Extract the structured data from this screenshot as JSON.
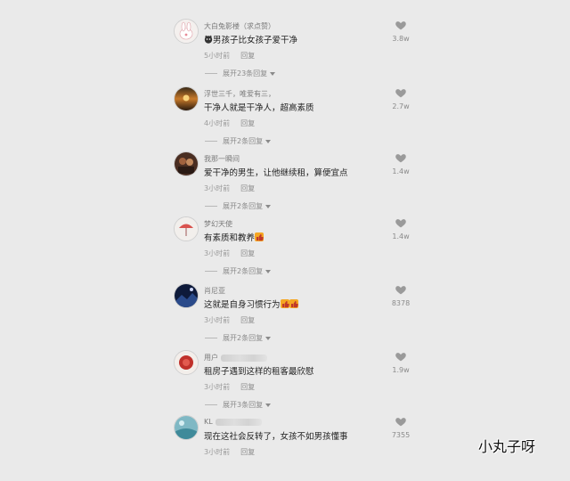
{
  "comments": [
    {
      "user": "大白兔影楼（求点赞）",
      "text": "男孩子比女孩子爱干净",
      "time": "5小时前",
      "reply": "回复",
      "expand": "展开23条回复",
      "likes": "3.8w",
      "avatar": "bunny-avatar"
    },
    {
      "user": "浮世三千，唯爱有三，",
      "text": "干净人就是干净人，超高素质",
      "time": "4小时前",
      "reply": "回复",
      "expand": "展开2条回复",
      "likes": "2.7w",
      "avatar": "sunset-avatar"
    },
    {
      "user": "我那一瞬间",
      "text": "爱干净的男生，让他继续租，算便宜点",
      "time": "3小时前",
      "reply": "回复",
      "expand": "展开2条回复",
      "likes": "1.4w",
      "avatar": "photo-avatar"
    },
    {
      "user": "梦幻天使",
      "text": "有素质和教养",
      "time": "3小时前",
      "reply": "回复",
      "expand": "展开2条回复",
      "likes": "1.4w",
      "avatar": "umbrella-avatar"
    },
    {
      "user": "肖尼亚",
      "text": "这就是自身习惯行为",
      "time": "3小时前",
      "reply": "回复",
      "expand": "展开2条回复",
      "likes": "8378",
      "avatar": "night-avatar"
    },
    {
      "user": "用户",
      "text": "租房子遇到这样的租客最欣慰",
      "time": "3小时前",
      "reply": "回复",
      "expand": "展开3条回复",
      "likes": "1.9w",
      "avatar": "red-avatar"
    },
    {
      "user": "KL",
      "text": "现在这社会反转了，女孩不如男孩懂事",
      "time": "3小时前",
      "reply": "回复",
      "expand": "",
      "likes": "7355",
      "avatar": "teal-avatar"
    }
  ],
  "watermark": "小丸子呀",
  "icons": {
    "like": "heart-icon",
    "expand": "chevron-down-icon",
    "thumbs_up": "thumbs-up-emoji"
  },
  "colors": {
    "background": "#eaeaea",
    "text": "#222222",
    "muted": "#8a8a8a"
  }
}
